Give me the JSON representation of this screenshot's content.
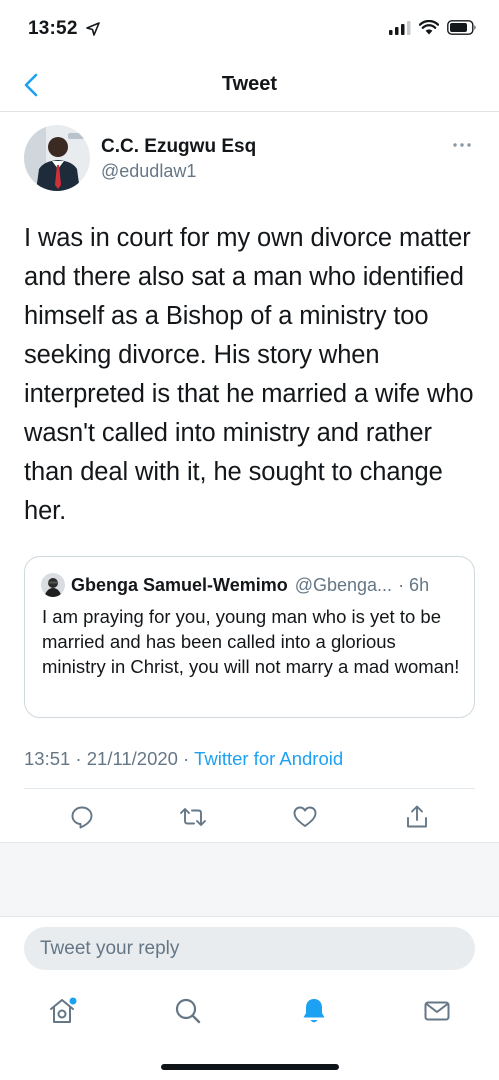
{
  "status_bar": {
    "time": "13:52",
    "icons": [
      "location-arrow-icon",
      "cellular-signal-icon",
      "wifi-icon",
      "battery-icon"
    ]
  },
  "nav": {
    "title": "Tweet",
    "back_icon": "chevron-left-icon"
  },
  "tweet": {
    "author_name": "C.C. Ezugwu Esq",
    "author_handle": "@edudlaw1",
    "more_icon": "more-horizontal-icon",
    "text": "I was in court for my own divorce matter and there also sat a man who identified himself as a Bishop of a ministry too seeking divorce. His story when interpreted is that he married a wife who wasn't called into ministry and rather than deal with it, he sought to change her.",
    "timestamp": "13:51 · 21/11/2020 · ",
    "source": "Twitter for Android"
  },
  "quote": {
    "author_name": "Gbenga Samuel-Wemimo",
    "author_handle": "@Gbenga...",
    "time_ago": "· 6h",
    "text": "I am praying for you, young man who is yet to be married and has been called into a glorious ministry in Christ, you will not marry a mad woman!"
  },
  "actions": [
    "reply-icon",
    "retweet-icon",
    "like-icon",
    "share-icon"
  ],
  "reply": {
    "placeholder": "Tweet your reply"
  },
  "tabs": [
    "home-icon",
    "search-icon",
    "notifications-icon",
    "messages-icon"
  ],
  "colors": {
    "accent": "#1da1f2",
    "secondary_text": "#657786",
    "border": "#cfd9de",
    "input_bg": "#e8ecef"
  }
}
